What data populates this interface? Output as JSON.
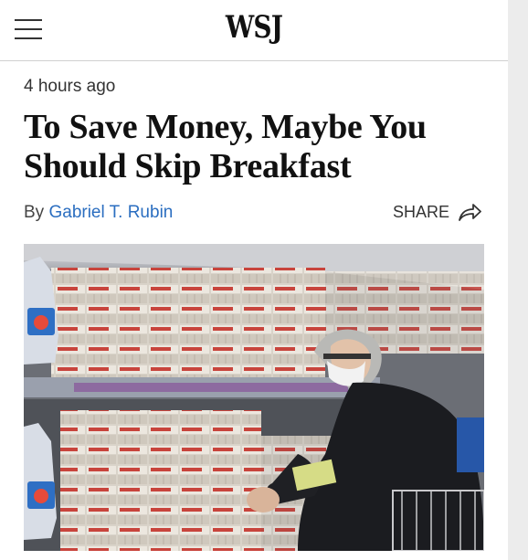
{
  "header": {
    "logo": "WSJ",
    "menu_icon": "hamburger-menu-icon"
  },
  "article": {
    "timestamp": "4 hours ago",
    "headline_line1": "To Save Money, Maybe You",
    "headline_line2": "Should Skip Breakfast",
    "byline_prefix": "By",
    "author": "Gabriel T. Rubin",
    "share_label": "SHARE",
    "share_icon": "share-arrow-icon"
  },
  "photo": {
    "subject": "egg-aisle-shopper-photo"
  },
  "colors": {
    "link": "#2b6ec0",
    "text": "#111111"
  }
}
